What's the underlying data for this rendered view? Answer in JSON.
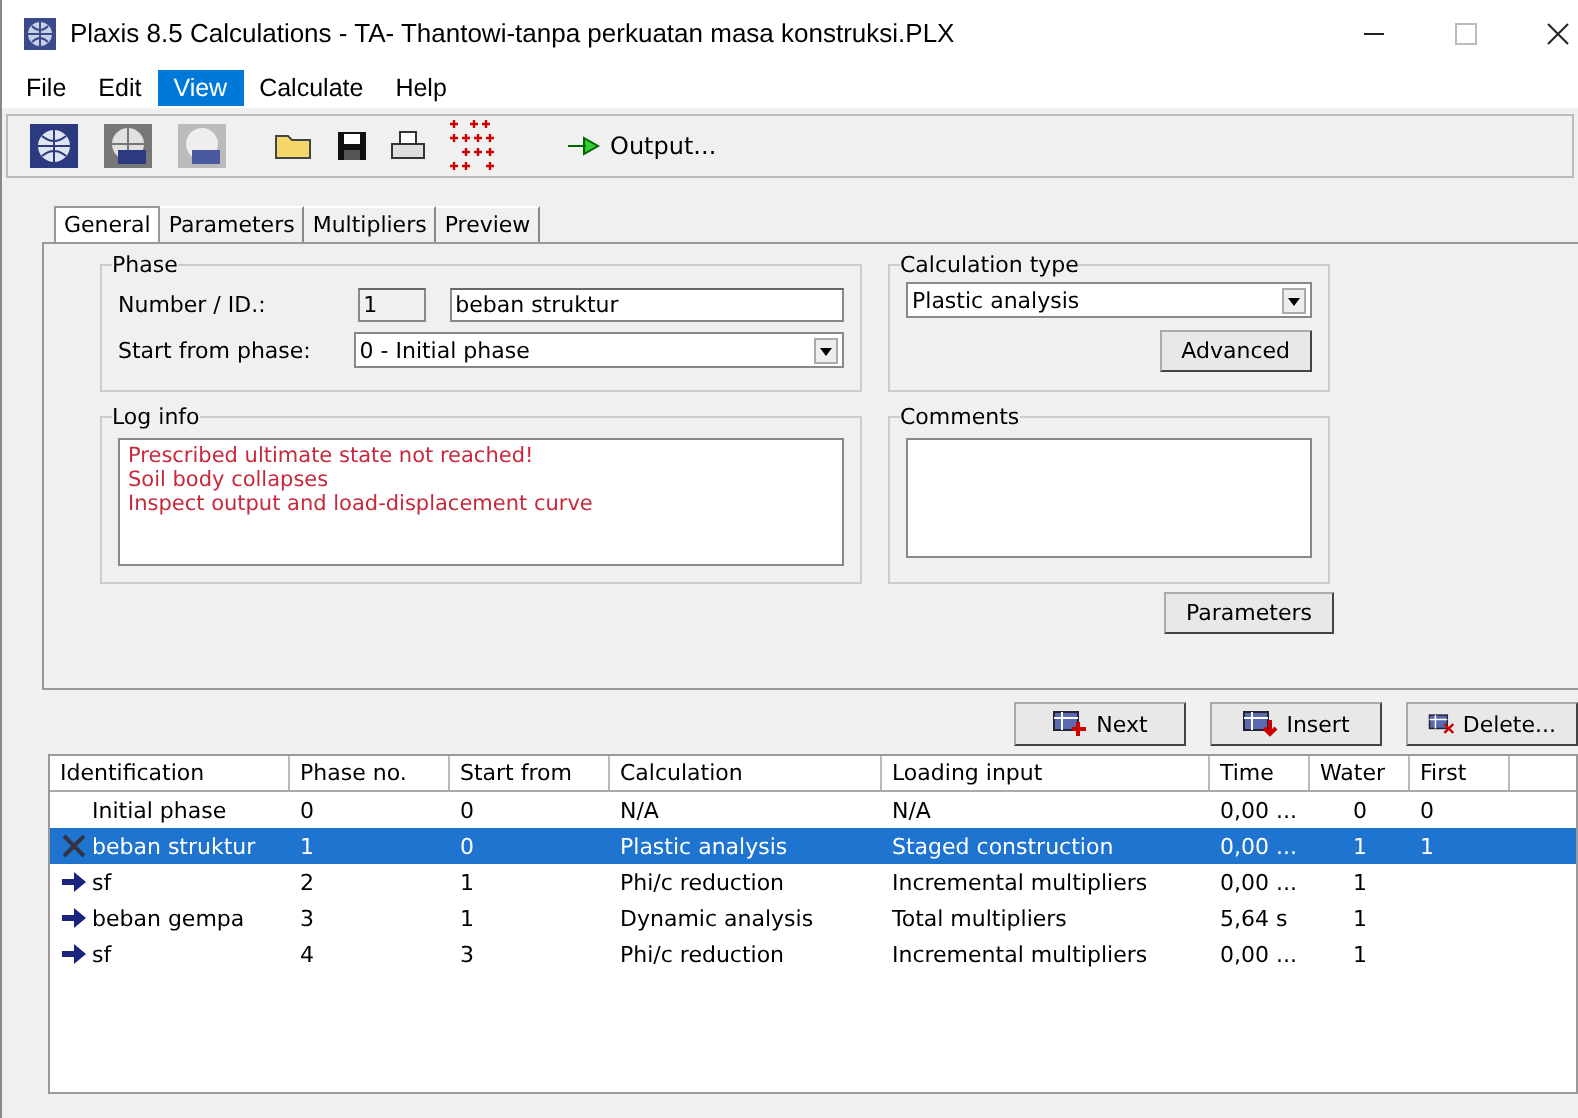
{
  "window": {
    "title": "Plaxis 8.5 Calculations - TA- Thantowi-tanpa perkuatan masa konstruksi.PLX"
  },
  "menu": [
    {
      "label": "File",
      "selected": false
    },
    {
      "label": "Edit",
      "selected": false
    },
    {
      "label": "View",
      "selected": true
    },
    {
      "label": "Calculate",
      "selected": false
    },
    {
      "label": "Help",
      "selected": false
    }
  ],
  "toolbar": {
    "output_button": "Output..."
  },
  "tabs": [
    {
      "label": "General",
      "selected": true
    },
    {
      "label": "Parameters",
      "selected": false
    },
    {
      "label": "Multipliers",
      "selected": false
    },
    {
      "label": "Preview",
      "selected": false
    }
  ],
  "phase": {
    "title": "Phase",
    "number_label": "Number / ID.:",
    "number": "1",
    "id": "beban struktur",
    "start_label": "Start from phase:",
    "start": "0 - Initial phase"
  },
  "calculation_type": {
    "title": "Calculation type",
    "value": "Plastic analysis",
    "advanced_button": "Advanced"
  },
  "log_info": {
    "title": "Log info",
    "lines": [
      "Prescribed ultimate state not reached!",
      "Soil body collapses",
      "Inspect output and load-displacement curve"
    ]
  },
  "comments": {
    "title": "Comments"
  },
  "parameters_button": "Parameters",
  "phase_buttons": [
    "Next",
    "Insert",
    "Delete..."
  ],
  "table": {
    "columns": [
      "Identification",
      "Phase no.",
      "Start from",
      "Calculation",
      "Loading input",
      "Time",
      "Water",
      "First"
    ],
    "rows": [
      {
        "kind": "none",
        "selected": false,
        "cells": [
          "Initial phase",
          "0",
          "0",
          "N/A",
          "N/A",
          "0,00 ...",
          "0",
          "0"
        ]
      },
      {
        "kind": "failed",
        "selected": true,
        "cells": [
          "beban struktur",
          "1",
          "0",
          "Plastic analysis",
          "Staged construction",
          "0,00 ...",
          "1",
          "1"
        ]
      },
      {
        "kind": "pending",
        "selected": false,
        "cells": [
          "sf",
          "2",
          "1",
          "Phi/c reduction",
          "Incremental multipliers",
          "0,00 ...",
          "1",
          ""
        ]
      },
      {
        "kind": "pending",
        "selected": false,
        "cells": [
          "beban gempa",
          "3",
          "1",
          "Dynamic analysis",
          "Total multipliers",
          "5,64 s",
          "1",
          ""
        ]
      },
      {
        "kind": "pending",
        "selected": false,
        "cells": [
          "sf",
          "4",
          "3",
          "Phi/c reduction",
          "Incremental multipliers",
          "0,00 ...",
          "1",
          ""
        ]
      }
    ]
  }
}
